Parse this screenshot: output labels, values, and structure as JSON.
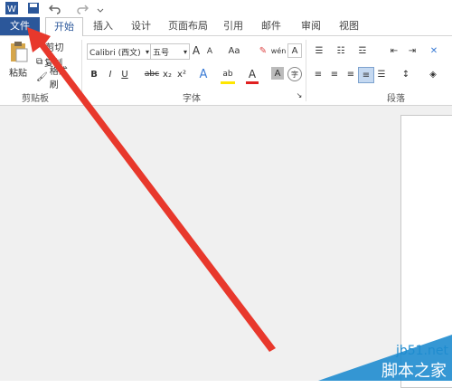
{
  "qat": {
    "icons": [
      "word-logo",
      "save-icon",
      "undo-icon",
      "redo-icon",
      "customize-icon"
    ]
  },
  "tabs": [
    {
      "label": "文件"
    },
    {
      "label": "开始"
    },
    {
      "label": "插入"
    },
    {
      "label": "设计"
    },
    {
      "label": "页面布局"
    },
    {
      "label": "引用"
    },
    {
      "label": "邮件"
    },
    {
      "label": "审阅"
    },
    {
      "label": "视图"
    }
  ],
  "clipboard": {
    "paste": "粘贴",
    "cut": "剪切",
    "copy": "复制",
    "format_painter": "格式刷",
    "group": "剪贴板"
  },
  "font": {
    "name": "Calibri (西文)",
    "size": "五号",
    "group": "字体",
    "grow": "A",
    "shrink": "A",
    "case": "Aa",
    "bold": "B",
    "italic": "I",
    "underline": "U",
    "strike": "abc",
    "sub": "x₂",
    "sup": "x²",
    "text_effects": "A",
    "highlight": "ab",
    "color": "A",
    "char_shade": "A",
    "enclose": "字",
    "border": "A",
    "phonetic": "wén"
  },
  "paragraph": {
    "group": "段落"
  },
  "watermark": {
    "site": "jb51.net",
    "name": "脚本之家"
  },
  "colors": {
    "file_tab": "#2b579a",
    "arrow": "#e8382c",
    "watermark": "#1f8ccf"
  }
}
